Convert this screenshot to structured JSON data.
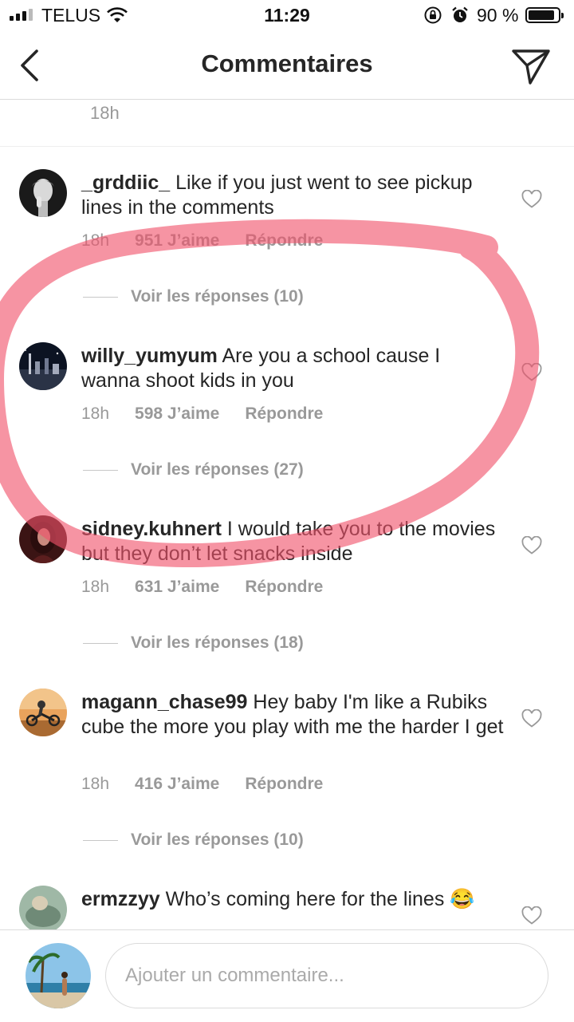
{
  "status_bar": {
    "carrier": "TELUS",
    "time": "11:29",
    "battery_percent": "90 %",
    "battery_level": 0.9
  },
  "nav": {
    "title": "Commentaires",
    "back_icon": "chevron-left-icon",
    "send_icon": "paper-plane-icon"
  },
  "top_comment_time": "18h",
  "comments": [
    {
      "username": "_grddiic_",
      "text": " Like if you just went to see pickup lines in the comments",
      "time": "18h",
      "likes": "951 J’aime",
      "reply": "Répondre",
      "view_replies": "Voir les réponses (10)"
    },
    {
      "username": "willy_yumyum",
      "text": " Are you a school cause I wanna shoot kids in you",
      "time": "18h",
      "likes": "598 J’aime",
      "reply": "Répondre",
      "view_replies": "Voir les réponses (27)"
    },
    {
      "username": "sidney.kuhnert",
      "text": " I would take you to the movies but they don’t let snacks inside",
      "time": "18h",
      "likes": "631 J’aime",
      "reply": "Répondre",
      "view_replies": "Voir les réponses (18)"
    },
    {
      "username": "magann_chase99",
      "text": " Hey baby I'm like a Rubiks cube the more you play with me the harder I get",
      "time": "18h",
      "likes": "416 J’aime",
      "reply": "Répondre",
      "view_replies": "Voir les réponses (10)"
    },
    {
      "username": "ermzzyy",
      "text": " Who’s coming here for the lines 😂"
    }
  ],
  "input": {
    "placeholder": "Ajouter un commentaire..."
  },
  "colors": {
    "annotation": "#f0536a",
    "secondary_text": "#999999",
    "divider": "#dbdbdb"
  }
}
